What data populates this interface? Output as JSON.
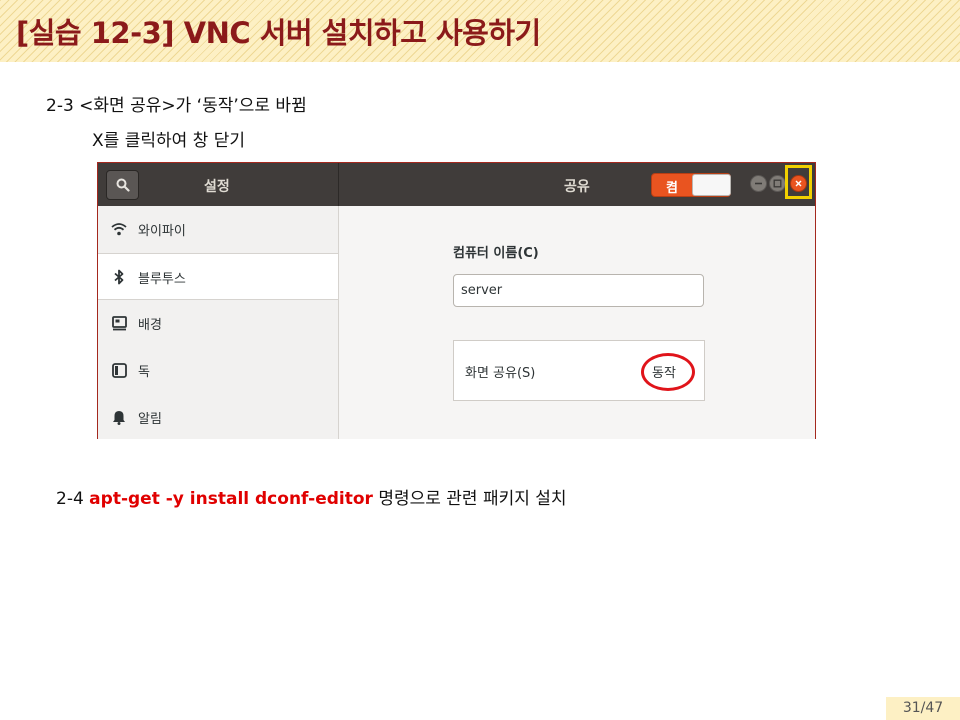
{
  "slide": {
    "title": "[실습 12-3] VNC 서버 설치하고 사용하기",
    "step3_line1": "2-3 <화면 공유>가 ‘동작’으로 바뀜",
    "step3_line2": "X를 클릭하여 창 닫기",
    "step4_prefix": "2-4 ",
    "step4_command": "apt-get  -y install dconf-editor",
    "step4_suffix": " 명령으로 관련 패키지 설치",
    "page_number": "31/47"
  },
  "window": {
    "left_title": "설정",
    "right_title": "공유",
    "toggle_label": "켬",
    "toggle_on": true
  },
  "sidebar": {
    "items": [
      {
        "label": "와이파이",
        "icon": "wifi-icon"
      },
      {
        "label": "블루투스",
        "icon": "bluetooth-icon",
        "selected": true
      },
      {
        "label": "배경",
        "icon": "background-icon"
      },
      {
        "label": "독",
        "icon": "dock-icon"
      },
      {
        "label": "알림",
        "icon": "bell-icon"
      }
    ]
  },
  "sharing": {
    "computer_name_label": "컴퓨터 이름(C)",
    "computer_name_value": "server",
    "screen_sharing_label": "화면 공유(S)",
    "screen_sharing_status": "동작"
  },
  "colors": {
    "title_text": "#8b1a1a",
    "command_text": "#e00000",
    "accent_orange": "#e95420",
    "highlight_yellow": "#f1d000",
    "highlight_red": "#e0141a"
  }
}
